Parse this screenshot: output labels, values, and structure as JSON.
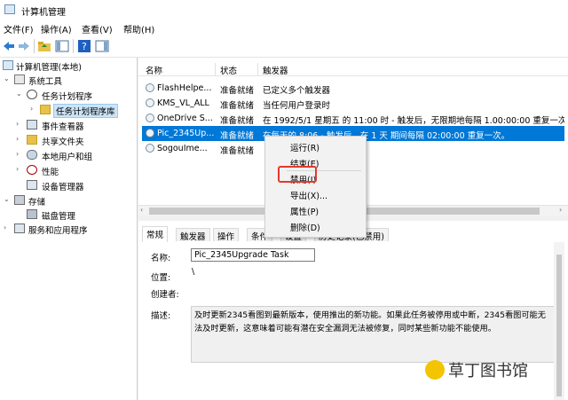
{
  "window": {
    "title": "计算机管理"
  },
  "menubar": [
    "文件(F)",
    "操作(A)",
    "查看(V)",
    "帮助(H)"
  ],
  "tree": {
    "items": [
      {
        "label": "计算机管理(本地)",
        "icon": "computer-icon"
      },
      {
        "label": "系统工具",
        "icon": "tools-icon"
      },
      {
        "label": "任务计划程序",
        "icon": "clock-icon"
      },
      {
        "label": "任务计划程序库",
        "icon": "folder-icon"
      },
      {
        "label": "事件查看器",
        "icon": "event-viewer-icon"
      },
      {
        "label": "共享文件夹",
        "icon": "shared-folder-icon"
      },
      {
        "label": "本地用户和组",
        "icon": "users-icon"
      },
      {
        "label": "性能",
        "icon": "performance-icon"
      },
      {
        "label": "设备管理器",
        "icon": "device-manager-icon"
      },
      {
        "label": "存储",
        "icon": "storage-icon"
      },
      {
        "label": "磁盘管理",
        "icon": "disk-icon"
      },
      {
        "label": "服务和应用程序",
        "icon": "services-icon"
      }
    ]
  },
  "list": {
    "columns": [
      "名称",
      "状态",
      "触发器"
    ],
    "rows": [
      {
        "name": "FlashHelpe...",
        "status": "准备就绪",
        "trigger": "已定义多个触发器"
      },
      {
        "name": "KMS_VL_ALL",
        "status": "准备就绪",
        "trigger": "当任何用户登录时"
      },
      {
        "name": "OneDrive S...",
        "status": "准备就绪",
        "trigger": "在 1992/5/1 星期五 的 11:00 时 - 触发后，无限期地每隔 1.00:00:00 重复一次。"
      },
      {
        "name": "Pic_2345Up...",
        "status": "准备就绪",
        "trigger": "在每天的 8:06 - 触发后，在 1 天 期间每隔 02:00:00 重复一次。"
      },
      {
        "name": "SogouIme...",
        "status": "准备就绪",
        "trigger": ""
      }
    ]
  },
  "tabs": [
    "常规",
    "触发器",
    "操作",
    "条件",
    "设置",
    "历史记录(已禁用)"
  ],
  "props": {
    "name_label": "名称:",
    "name_value": "Pic_2345Upgrade Task",
    "location_label": "位置:",
    "location_value": "\\",
    "author_label": "创建者:",
    "desc_label": "描述:",
    "desc_value": "及时更新2345看图到最新版本，使用推出的新功能。如果此任务被停用或中断，2345看图可能无法及时更新，这意味着可能有潜在安全漏洞无法被修复，同时某些新功能不能使用。"
  },
  "context_menu": {
    "items": [
      "运行(R)",
      "结束(E)",
      "禁用(I)",
      "导出(X)...",
      "属性(P)",
      "删除(D)"
    ],
    "highlight_color": "#e03a2e"
  },
  "watermark": {
    "text": "草丁图书馆"
  },
  "colors": {
    "selection": "#0078d7",
    "tree_selection": "#cce4f7"
  }
}
